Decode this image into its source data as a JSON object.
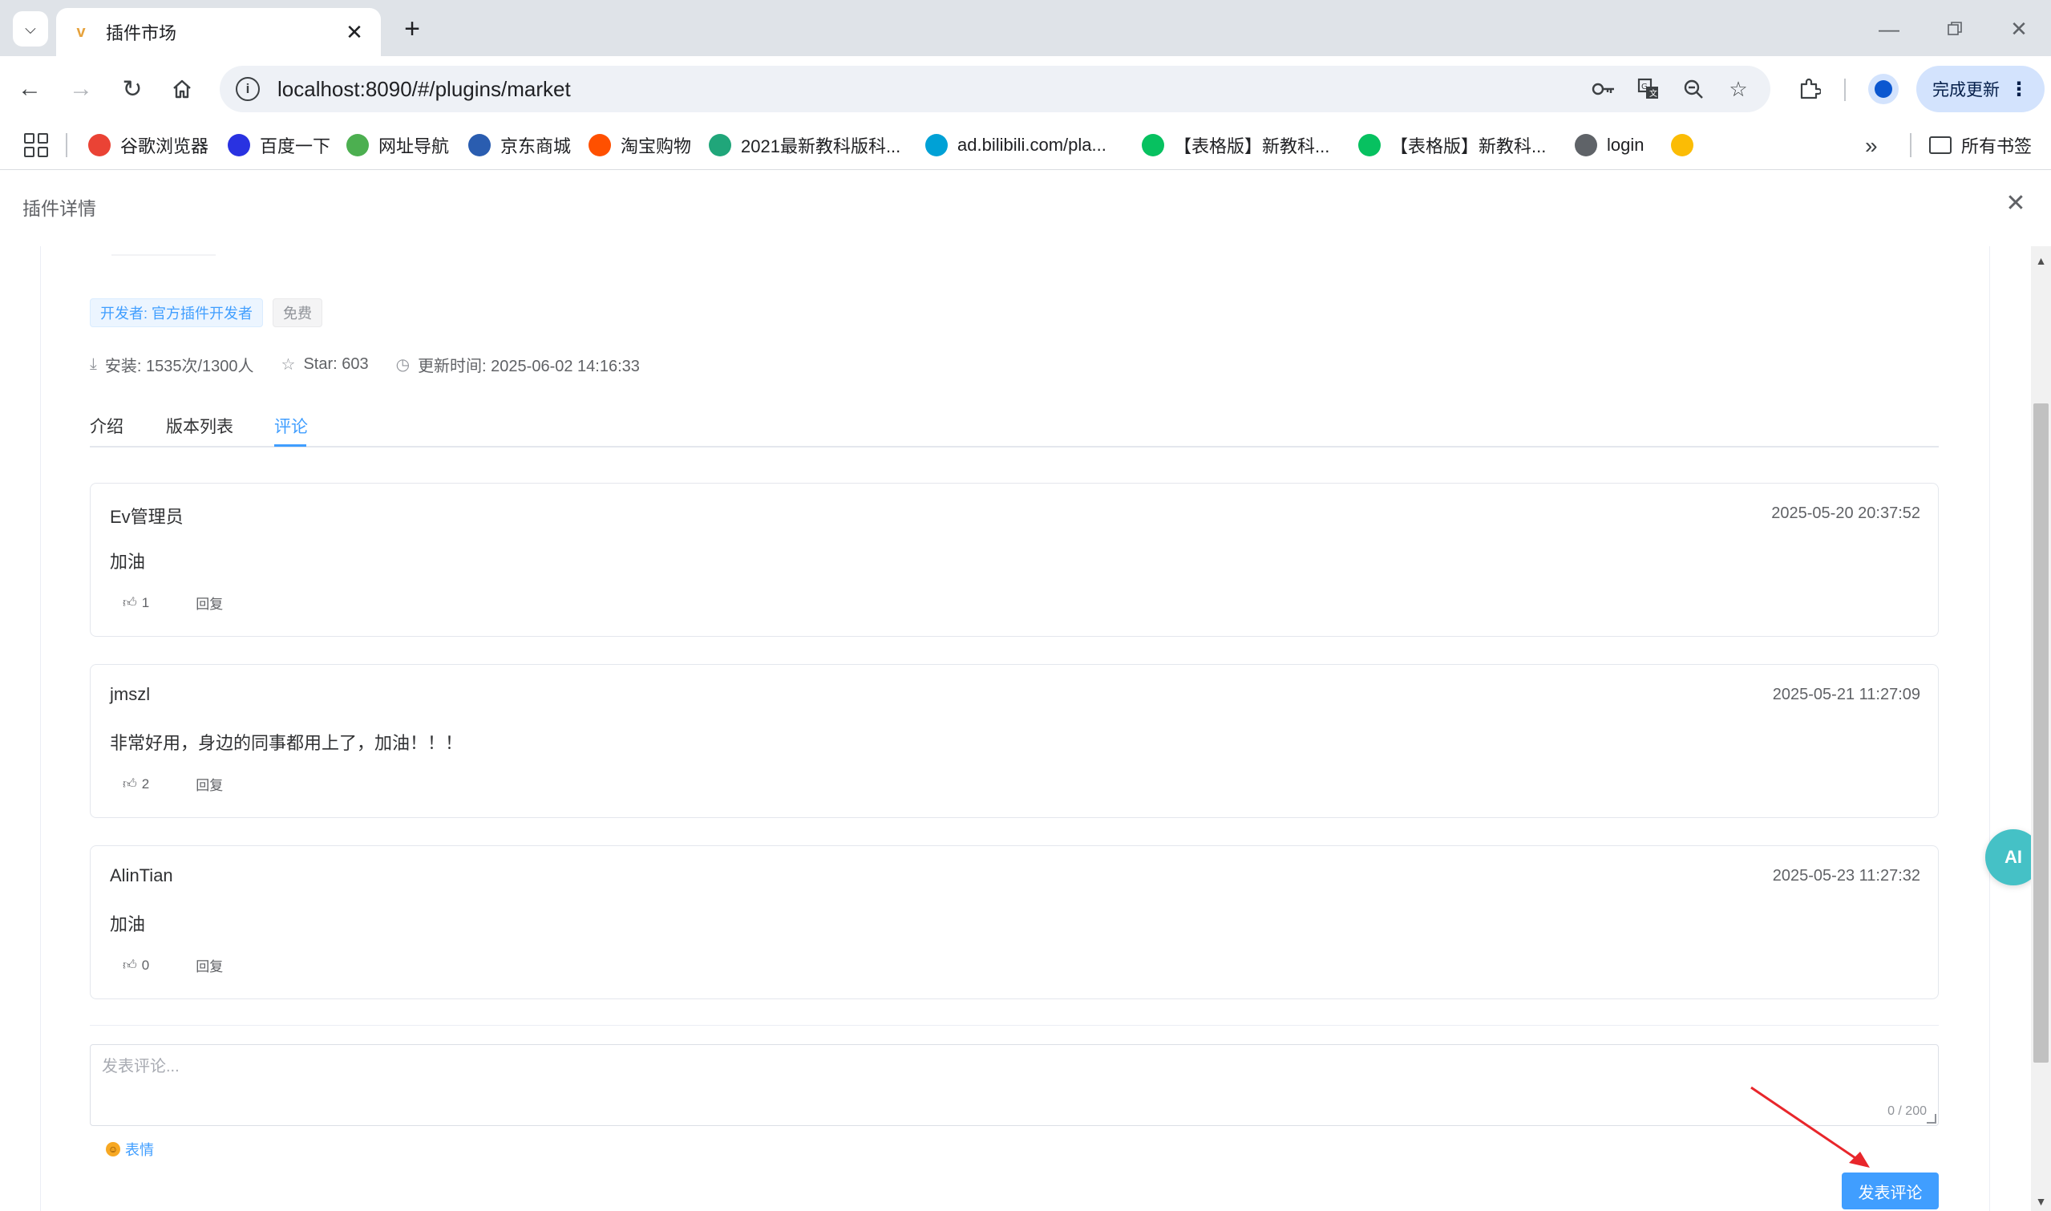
{
  "browser": {
    "tab": {
      "title": "插件市场",
      "favicon": "v"
    },
    "address": {
      "url": "localhost:8090/#/plugins/market"
    },
    "update_label": "完成更新",
    "bookmarks": [
      {
        "label": "谷歌浏览器",
        "icon": "chrome-icon",
        "color": "#ea4335"
      },
      {
        "label": "百度一下",
        "icon": "baidu-icon",
        "color": "#2932e1"
      },
      {
        "label": "网址导航",
        "icon": "hao-icon",
        "color": "#4caf50"
      },
      {
        "label": "京东商城",
        "icon": "jd-icon",
        "color": "#2a5db0"
      },
      {
        "label": "淘宝购物",
        "icon": "taobao-icon",
        "color": "#ff5000"
      },
      {
        "label": "2021最新教科版科...",
        "icon": "doc-icon",
        "color": "#20a67a"
      },
      {
        "label": "ad.bilibili.com/pla...",
        "icon": "bilibili-icon",
        "color": "#00a1d6"
      },
      {
        "label": "【表格版】新教科...",
        "icon": "wechat-icon",
        "color": "#07c160"
      },
      {
        "label": "【表格版】新教科...",
        "icon": "wechat-icon",
        "color": "#07c160"
      },
      {
        "label": "login",
        "icon": "globe-icon",
        "color": "#5f6368"
      },
      {
        "label": "",
        "icon": "colorful-icon",
        "color": "#fbbc05"
      }
    ],
    "all_bookmarks_label": "所有书签"
  },
  "page": {
    "title": "插件详情",
    "tags": {
      "developer": "开发者: 官方插件开发者",
      "price": "免费"
    },
    "meta": {
      "installs": "安装: 1535次/1300人",
      "stars": "Star: 603",
      "updated": "更新时间: 2025-06-02 14:16:33"
    },
    "tabs": [
      {
        "label": "介绍"
      },
      {
        "label": "版本列表"
      },
      {
        "label": "评论"
      }
    ],
    "active_tab": "评论",
    "comments": [
      {
        "user": "Ev管理员",
        "time": "2025-05-20 20:37:52",
        "text": "加油",
        "likes": "1",
        "reply": "回复"
      },
      {
        "user": "jmszl",
        "time": "2025-05-21 11:27:09",
        "text": "非常好用，身边的同事都用上了，加油！！！",
        "likes": "2",
        "reply": "回复"
      },
      {
        "user": "AlinTian",
        "time": "2025-05-23 11:27:32",
        "text": "加油",
        "likes": "0",
        "reply": "回复"
      }
    ],
    "composer": {
      "placeholder": "发表评论...",
      "counter": "0 / 200",
      "emoji_label": "表情",
      "submit_label": "发表评论"
    },
    "ai_button": "AI"
  },
  "colors": {
    "primary": "#409eff",
    "ai_float": "#45c1c6",
    "annotation_arrow": "#e8262b"
  }
}
